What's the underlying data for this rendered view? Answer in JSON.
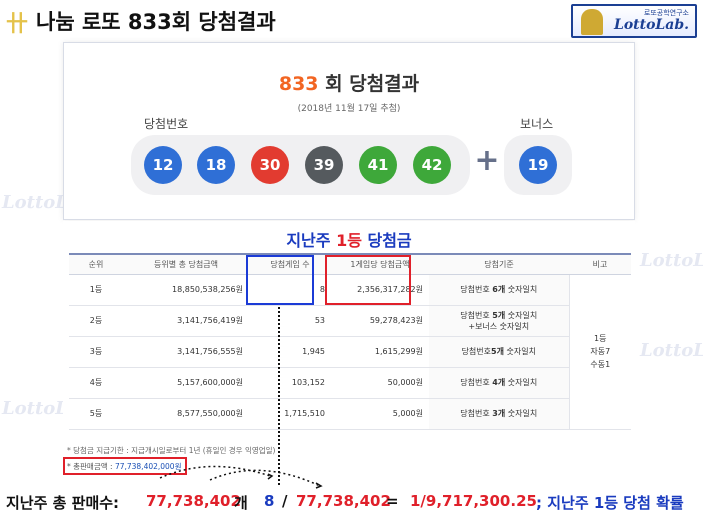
{
  "header": {
    "glyph": "卄",
    "title": "나눔 로또 833회 당첨결과",
    "logo": {
      "subtitle": "로또공학연구소",
      "name": "LottoLab."
    }
  },
  "result": {
    "draw_no": "833",
    "draw_suffix": " 회 당첨결과",
    "date": "(2018년 11월 17일 추첨)",
    "winning_label": "당첨번호",
    "bonus_label": "보너스",
    "numbers": [
      "12",
      "18",
      "30",
      "39",
      "41",
      "42"
    ],
    "number_colors": [
      "#2f6fd6",
      "#2f6fd6",
      "#e23b30",
      "#555a5e",
      "#3ea83a",
      "#3ea83a"
    ],
    "plus": "+",
    "bonus": "19",
    "bonus_color": "#2f6fd6"
  },
  "watermark": "LottoLab.",
  "prize": {
    "title_pre": "지난주 ",
    "title_hl": "1등",
    "title_post": " 당첨금",
    "columns": [
      "순위",
      "등위별 총 당첨금액",
      "당첨게임 수",
      "1게임당 당첨금액",
      "당첨기준",
      "비고"
    ],
    "rows": [
      {
        "rank": "1등",
        "total": "18,850,538,256원",
        "games": "8",
        "per": "2,356,317,282원",
        "crit_a": "당첨번호 ",
        "crit_b": "6개",
        "crit_c": " 숫자일치",
        "crit_d": ""
      },
      {
        "rank": "2등",
        "total": "3,141,756,419원",
        "games": "53",
        "per": "59,278,423원",
        "crit_a": "당첨번호 ",
        "crit_b": "5개",
        "crit_c": " 숫자일치",
        "crit_d": "+보너스 숫자일치"
      },
      {
        "rank": "3등",
        "total": "3,141,756,555원",
        "games": "1,945",
        "per": "1,615,299원",
        "crit_a": "당첨번호",
        "crit_b": "5개",
        "crit_c": " 숫자일치",
        "crit_d": ""
      },
      {
        "rank": "4등",
        "total": "5,157,600,000원",
        "games": "103,152",
        "per": "50,000원",
        "crit_a": "당첨번호 ",
        "crit_b": "4개",
        "crit_c": " 숫자일치",
        "crit_d": ""
      },
      {
        "rank": "5등",
        "total": "8,577,550,000원",
        "games": "1,715,510",
        "per": "5,000원",
        "crit_a": "당첨번호 ",
        "crit_b": "3개",
        "crit_c": " 숫자일치",
        "crit_d": ""
      }
    ],
    "note": [
      "1등",
      "자동7",
      "수동1"
    ],
    "footnote1": "* 당첨금 지급기한 : 지급개시일로부터 1년 (휴일인 경우 익영업일)",
    "footnote2_label": "* 총판매금액 : ",
    "footnote2_value": "77,738,402,000원"
  },
  "formula": {
    "prefix": "지난주 총 판매수: ",
    "sales": "77,738,402",
    "unit": " 개",
    "winners": "8",
    "slash": "/",
    "sales2": "77,738,402",
    "eq": "=",
    "odds": "1/9,717,300.25",
    "suffix": "; 지난주 1등 당첨 확률"
  }
}
